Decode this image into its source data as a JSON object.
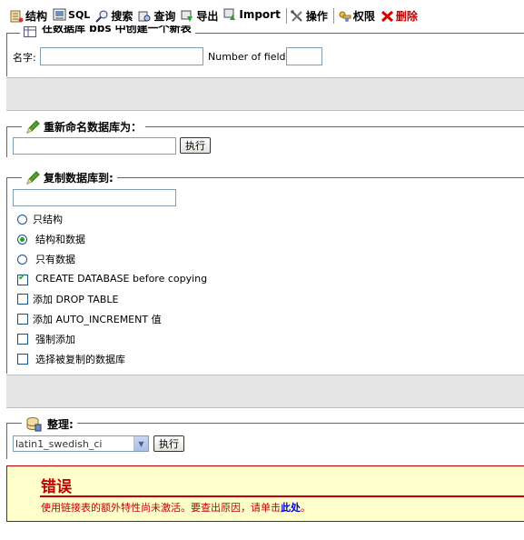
{
  "tabs": [
    {
      "label": "结构",
      "icon": "structure-icon"
    },
    {
      "label": "SQL",
      "icon": "sql-icon"
    },
    {
      "label": "搜索",
      "icon": "search-icon"
    },
    {
      "label": "查询",
      "icon": "query-icon"
    },
    {
      "label": "导出",
      "icon": "export-icon"
    },
    {
      "label": "Import",
      "icon": "import-icon"
    },
    {
      "label": "操作",
      "icon": "operations-icon"
    },
    {
      "label": "权限",
      "icon": "privileges-icon"
    },
    {
      "label": "删除",
      "icon": "delete-icon"
    }
  ],
  "create_table": {
    "legend": "在数据库 bbs 中创建一个新表",
    "name_label": "名字:",
    "name_value": "",
    "fields_label": "Number of fields:",
    "fields_value": ""
  },
  "rename": {
    "legend": "重新命名数据库为：",
    "value": "",
    "go_label": "执行"
  },
  "copy": {
    "legend": "复制数据库到:",
    "value": "",
    "options": {
      "structure_only": "只结构",
      "structure_and_data": "结构和数据",
      "data_only": "只有数据"
    },
    "selected": "structure_and_data",
    "create_database": "CREATE DATABASE before copying",
    "create_database_checked": true,
    "add_drop_table": "添加 DROP TABLE",
    "add_auto_increment": "添加 AUTO_INCREMENT 值",
    "add_constraints": "强制添加",
    "switch_to_copied": "选择被复制的数据库"
  },
  "collation": {
    "legend": "整理:",
    "selected": "latin1_swedish_ci",
    "go_label": "执行"
  },
  "error": {
    "title": "错误",
    "message": "使用链接表的额外特性尚未激活。要查出原因，请单击",
    "link": "此处",
    "end": "。"
  }
}
